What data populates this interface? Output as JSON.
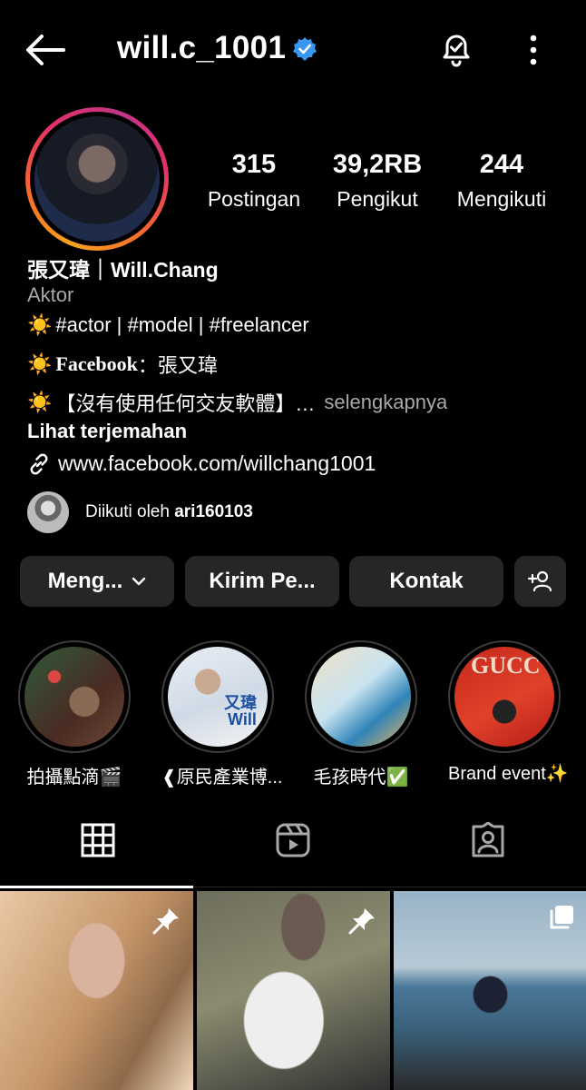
{
  "header": {
    "username": "will.c_1001"
  },
  "stats": {
    "posts": {
      "value": "315",
      "label": "Postingan"
    },
    "followers": {
      "value": "39,2RB",
      "label": "Pengikut"
    },
    "following": {
      "value": "244",
      "label": "Mengikuti"
    }
  },
  "bio": {
    "full_name": "張又瑋｜Will.Chang",
    "category": "Aktor",
    "line1": "#actor | #model | #freelancer",
    "line2_label": "Facebook",
    "line2_value": "：張又瑋",
    "line3": "【沒有使用任何交友軟體】…",
    "more": "selengkapnya",
    "see_translation": "Lihat terjemahan",
    "website": "www.facebook.com/willchang1001",
    "sun_icon": "☀️"
  },
  "followed_by": {
    "prefix": "Diikuti oleh",
    "user": "ari160103"
  },
  "actions": {
    "follow": "Meng...",
    "message": "Kirim Pe...",
    "contact": "Kontak"
  },
  "highlights": [
    {
      "label": "拍攝點滴🎬"
    },
    {
      "label": "❰原民產業博...",
      "image_text_1": "又瑋",
      "image_text_2": "Will"
    },
    {
      "label": "毛孩時代✅"
    },
    {
      "label": "Brand event✨",
      "image_text_1": "GUCC"
    }
  ],
  "colors": {
    "background": "#000000",
    "button_bg": "#262626",
    "secondary_text": "#a8a8a8",
    "verified_blue": "#3897f0"
  }
}
